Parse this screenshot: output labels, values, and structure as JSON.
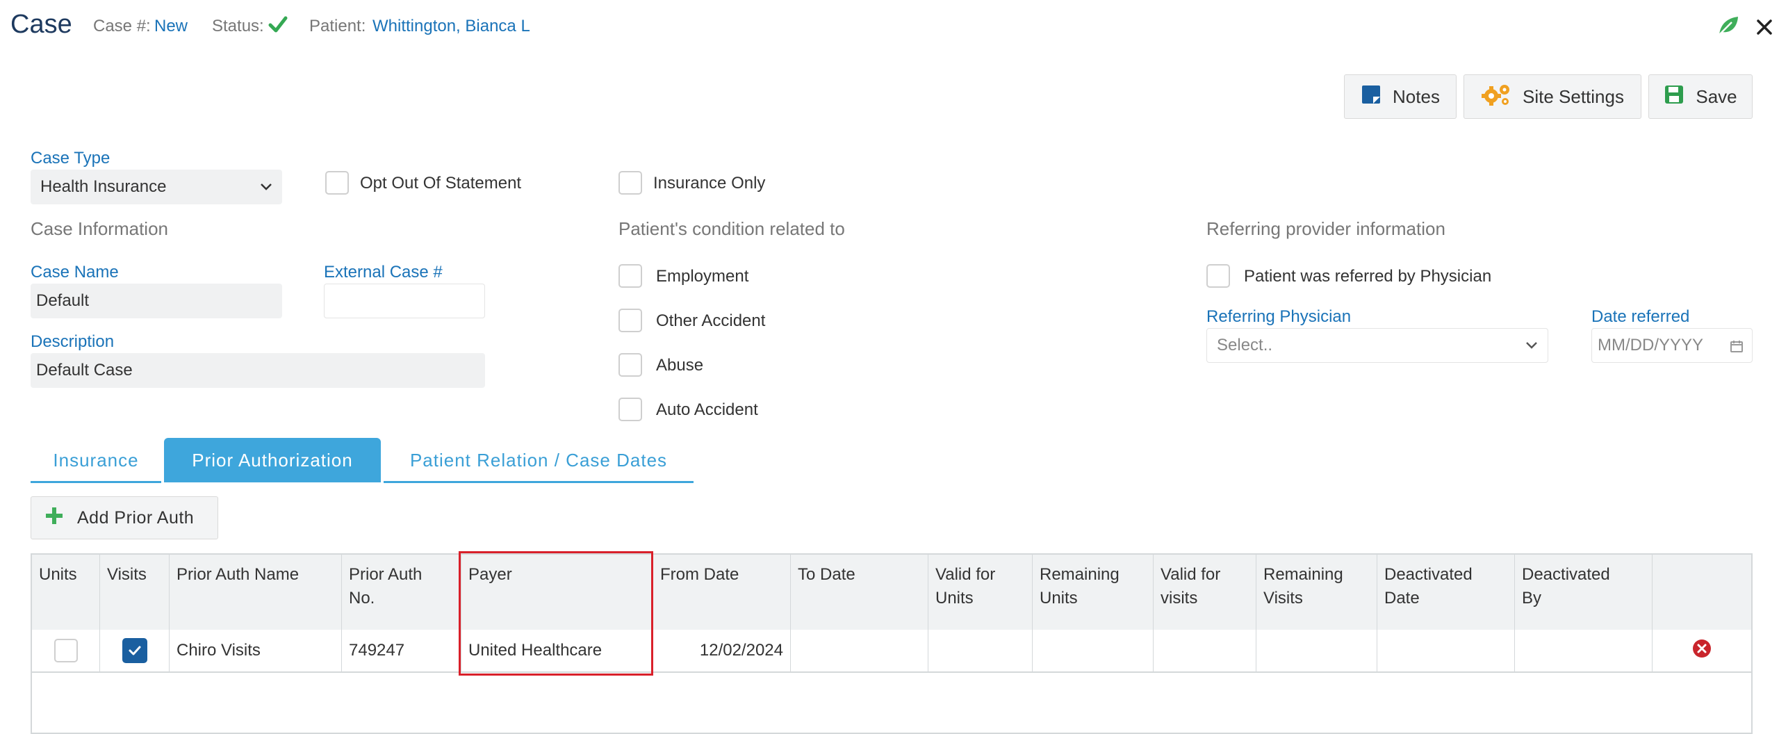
{
  "header": {
    "title": "Case",
    "case_num_label": "Case #:",
    "case_num_value": "New",
    "status_label": "Status:",
    "patient_label": "Patient:",
    "patient_value": "Whittington, Bianca L"
  },
  "toolbar": {
    "notes_label": "Notes",
    "site_settings_label": "Site Settings",
    "save_label": "Save"
  },
  "form": {
    "case_type_label": "Case Type",
    "case_type_value": "Health Insurance",
    "opt_out_label": "Opt Out Of Statement",
    "insurance_only_label": "Insurance Only",
    "case_information_label": "Case Information",
    "case_name_label": "Case Name",
    "case_name_value": "Default",
    "external_case_label": "External Case #",
    "external_case_value": "",
    "description_label": "Description",
    "description_value": "Default Case",
    "condition_label": "Patient's condition related to",
    "employment_label": "Employment",
    "other_accident_label": "Other Accident",
    "abuse_label": "Abuse",
    "auto_accident_label": "Auto Accident",
    "referring_info_label": "Referring provider information",
    "referred_by_label": "Patient was referred by Physician",
    "referring_physician_label": "Referring Physician",
    "referring_physician_placeholder": "Select..",
    "date_referred_label": "Date referred",
    "date_referred_placeholder": "MM/DD/YYYY"
  },
  "tabs": [
    {
      "label": "Insurance"
    },
    {
      "label": "Prior Authorization"
    },
    {
      "label": "Patient Relation / Case Dates"
    }
  ],
  "add_prior_auth_label": "Add Prior Auth",
  "table": {
    "headers": [
      "Units",
      "Visits",
      "Prior Auth Name",
      "Prior Auth No.",
      "Payer",
      "From Date",
      "To Date",
      "Valid for Units",
      "Remaining Units",
      "Valid for visits",
      "Remaining Visits",
      "Deactivated Date",
      "Deactivated By",
      ""
    ],
    "rows": [
      {
        "units_checked": false,
        "visits_checked": true,
        "prior_auth_name": "Chiro Visits",
        "prior_auth_no": "749247",
        "payer": "United Healthcare",
        "from_date": "12/02/2024",
        "to_date": "",
        "valid_for_units": "",
        "remaining_units": "",
        "valid_for_visits": "",
        "remaining_visits": "",
        "deactivated_date": "",
        "deactivated_by": ""
      }
    ]
  },
  "colors": {
    "accent": "#3ea6dc",
    "link": "#1a73b8",
    "highlight": "#d9202a"
  }
}
